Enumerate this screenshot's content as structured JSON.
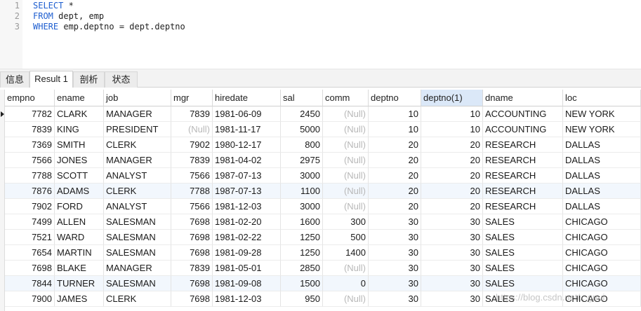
{
  "editor": {
    "lines": [
      {
        "num": "1",
        "keyword": "SELECT",
        "rest": " *"
      },
      {
        "num": "2",
        "keyword": "FROM",
        "rest": " dept, emp"
      },
      {
        "num": "3",
        "keyword": "WHERE",
        "rest": " emp.deptno = dept.deptno"
      }
    ]
  },
  "tabs": [
    {
      "label": "信息",
      "active": false
    },
    {
      "label": "Result 1",
      "active": true
    },
    {
      "label": "剖析",
      "active": false
    },
    {
      "label": "状态",
      "active": false
    }
  ],
  "grid": {
    "columns": [
      "empno",
      "ename",
      "job",
      "mgr",
      "hiredate",
      "sal",
      "comm",
      "deptno",
      "deptno(1)",
      "dname",
      "loc"
    ],
    "highlighted_column": "deptno(1)",
    "null_text": "(Null)",
    "rows": [
      [
        "7782",
        "CLARK",
        "MANAGER",
        "7839",
        "1981-06-09",
        "2450",
        null,
        "10",
        "10",
        "ACCOUNTING",
        "NEW YORK"
      ],
      [
        "7839",
        "KING",
        "PRESIDENT",
        null,
        "1981-11-17",
        "5000",
        null,
        "10",
        "10",
        "ACCOUNTING",
        "NEW YORK"
      ],
      [
        "7369",
        "SMITH",
        "CLERK",
        "7902",
        "1980-12-17",
        "800",
        null,
        "20",
        "20",
        "RESEARCH",
        "DALLAS"
      ],
      [
        "7566",
        "JONES",
        "MANAGER",
        "7839",
        "1981-04-02",
        "2975",
        null,
        "20",
        "20",
        "RESEARCH",
        "DALLAS"
      ],
      [
        "7788",
        "SCOTT",
        "ANALYST",
        "7566",
        "1987-07-13",
        "3000",
        null,
        "20",
        "20",
        "RESEARCH",
        "DALLAS"
      ],
      [
        "7876",
        "ADAMS",
        "CLERK",
        "7788",
        "1987-07-13",
        "1100",
        null,
        "20",
        "20",
        "RESEARCH",
        "DALLAS"
      ],
      [
        "7902",
        "FORD",
        "ANALYST",
        "7566",
        "1981-12-03",
        "3000",
        null,
        "20",
        "20",
        "RESEARCH",
        "DALLAS"
      ],
      [
        "7499",
        "ALLEN",
        "SALESMAN",
        "7698",
        "1981-02-20",
        "1600",
        "300",
        "30",
        "30",
        "SALES",
        "CHICAGO"
      ],
      [
        "7521",
        "WARD",
        "SALESMAN",
        "7698",
        "1981-02-22",
        "1250",
        "500",
        "30",
        "30",
        "SALES",
        "CHICAGO"
      ],
      [
        "7654",
        "MARTIN",
        "SALESMAN",
        "7698",
        "1981-09-28",
        "1250",
        "1400",
        "30",
        "30",
        "SALES",
        "CHICAGO"
      ],
      [
        "7698",
        "BLAKE",
        "MANAGER",
        "7839",
        "1981-05-01",
        "2850",
        null,
        "30",
        "30",
        "SALES",
        "CHICAGO"
      ],
      [
        "7844",
        "TURNER",
        "SALESMAN",
        "7698",
        "1981-09-08",
        "1500",
        "0",
        "30",
        "30",
        "SALES",
        "CHICAGO"
      ],
      [
        "7900",
        "JAMES",
        "CLERK",
        "7698",
        "1981-12-03",
        "950",
        null,
        "30",
        "30",
        "SALES",
        "CHICAGO"
      ]
    ]
  },
  "watermark": "https://blog.csdn.net/...gnui"
}
